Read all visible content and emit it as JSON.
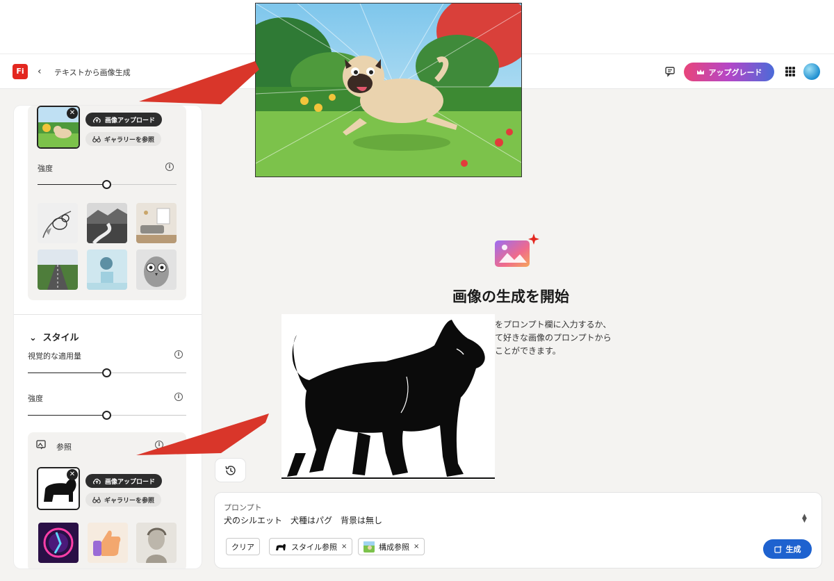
{
  "app": {
    "logo_text": "Fi",
    "back_glyph": "‹",
    "title": "テキストから画像生成"
  },
  "header": {
    "upgrade_label": "アップグレード",
    "upgrade_icon": "crown-icon",
    "feedback_icon": "feedback-icon",
    "apps_icon": "apps-grid-icon"
  },
  "composition": {
    "upload_label": "画像アップロード",
    "gallery_label": "ギャラリーを参照",
    "strength_label": "強度",
    "strength_value": 0.45,
    "presets": [
      "bird-sketch",
      "river-landscape",
      "living-room",
      "road-field",
      "sphere-pedestal",
      "owl-sketch"
    ]
  },
  "style": {
    "title": "スタイル",
    "visual_amount_label": "視覚的な適用量",
    "visual_amount_value": 0.5,
    "strength_label": "強度",
    "strength_value": 0.5,
    "reference_label": "参照",
    "upload_label": "画像アップロード",
    "gallery_label": "ギャラリーを参照",
    "presets": [
      "neon-dancer",
      "thumbs-up-3d",
      "classical-bust"
    ]
  },
  "empty_state": {
    "title": "画像の生成を開始",
    "description": "をプロンプト欄に入力するか、\nて好きな画像のプロンプトから\nことができます。"
  },
  "prompt": {
    "label": "プロンプト",
    "text": "犬のシルエット　犬種はパグ　背景は無し",
    "clear_label": "クリア",
    "style_ref_label": "スタイル参照",
    "comp_ref_label": "構成参照",
    "remove_glyph": "×",
    "generate_label": "生成"
  },
  "colors": {
    "logo": "#e3271f",
    "generate": "#1e62cf",
    "annotation_arrow": "#d9362a"
  }
}
